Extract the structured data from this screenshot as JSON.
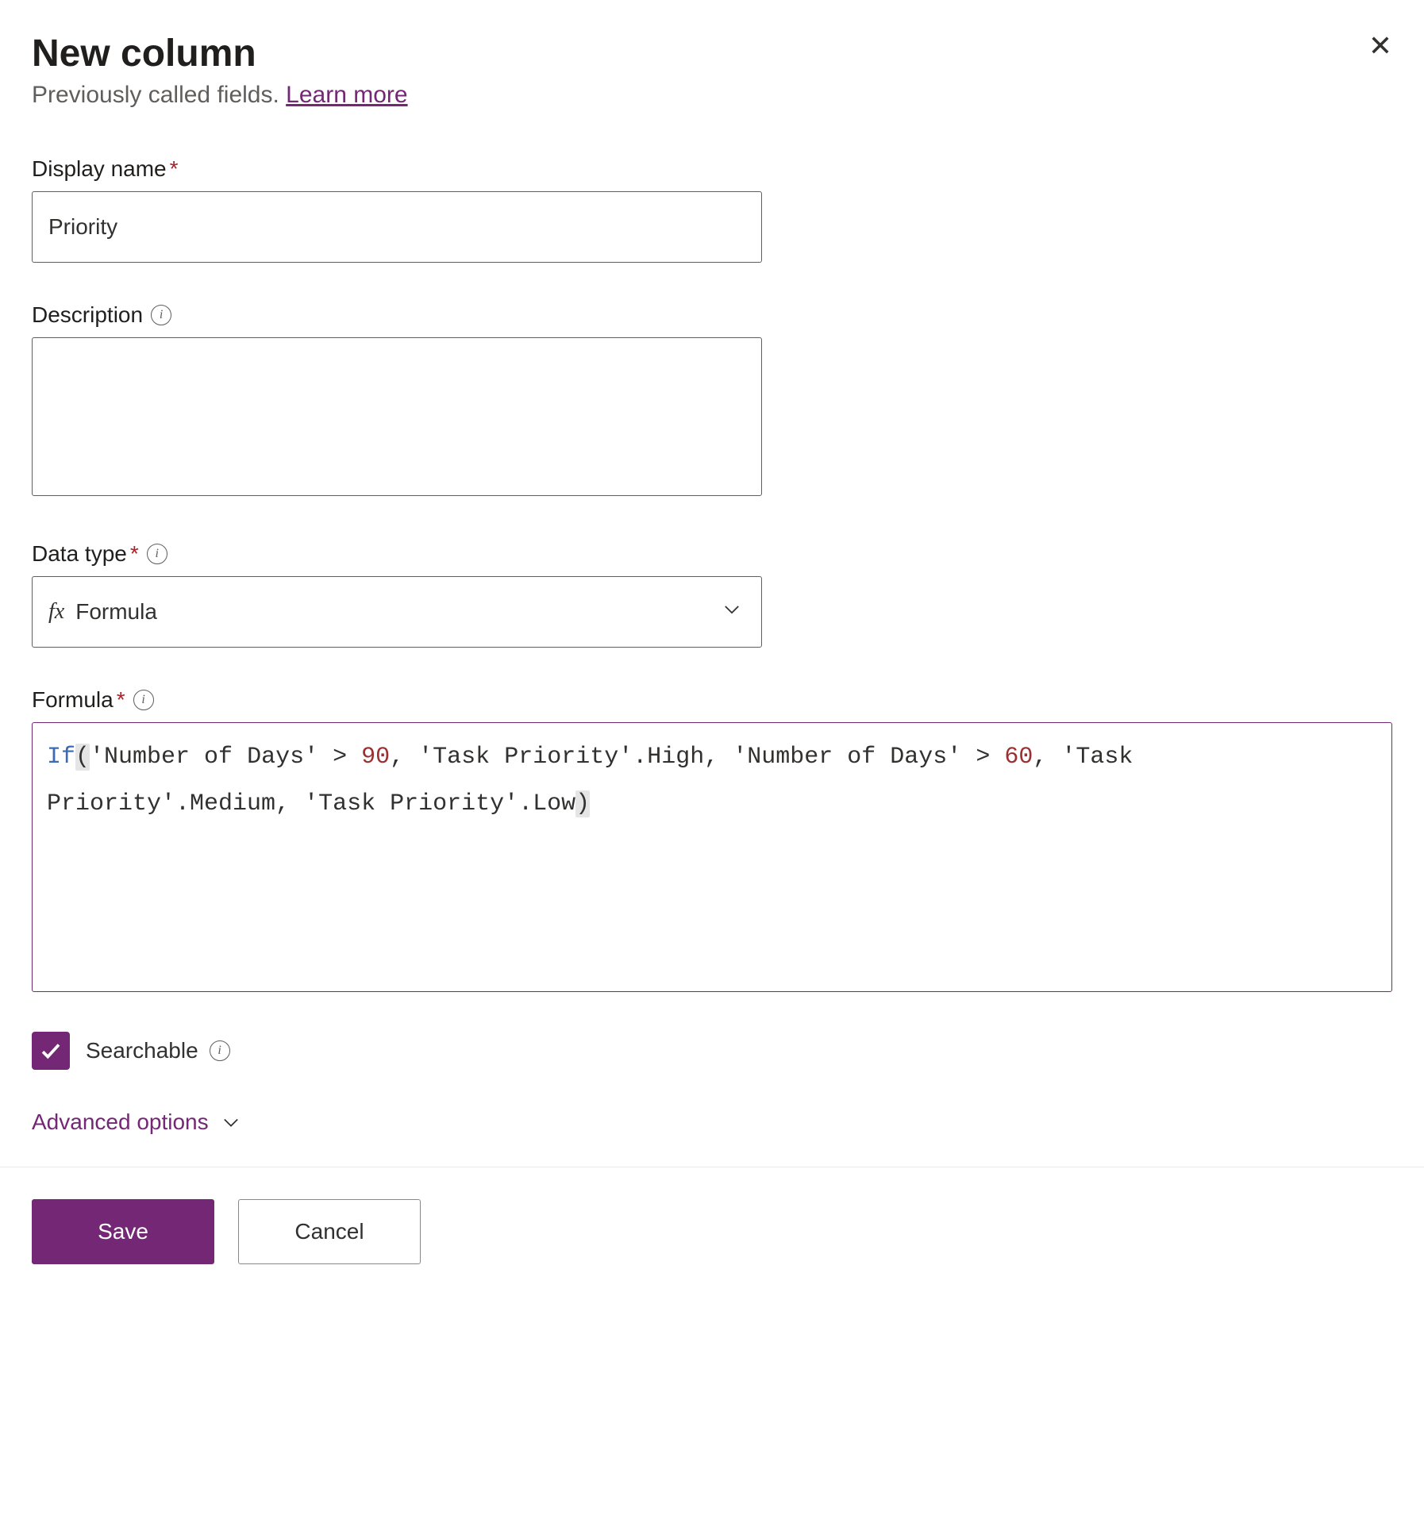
{
  "header": {
    "title": "New column",
    "subtitle_text": "Previously called fields. ",
    "learn_more": "Learn more"
  },
  "fields": {
    "display_name": {
      "label": "Display name",
      "value": "Priority"
    },
    "description": {
      "label": "Description",
      "value": ""
    },
    "data_type": {
      "label": "Data type",
      "value": "Formula"
    },
    "formula": {
      "label": "Formula",
      "tokens": {
        "if": "If",
        "num_days": "'Number of Days'",
        "gt": ">",
        "n90": "90",
        "high": "'Task Priority'.High",
        "n60": "60",
        "medium": "'Task Priority'.Medium",
        "low": "'Task Priority'.Low",
        "comma": ","
      }
    }
  },
  "checkbox": {
    "searchable": "Searchable"
  },
  "advanced": "Advanced options",
  "buttons": {
    "save": "Save",
    "cancel": "Cancel"
  },
  "info_glyph": "i",
  "fx_glyph": "fx"
}
